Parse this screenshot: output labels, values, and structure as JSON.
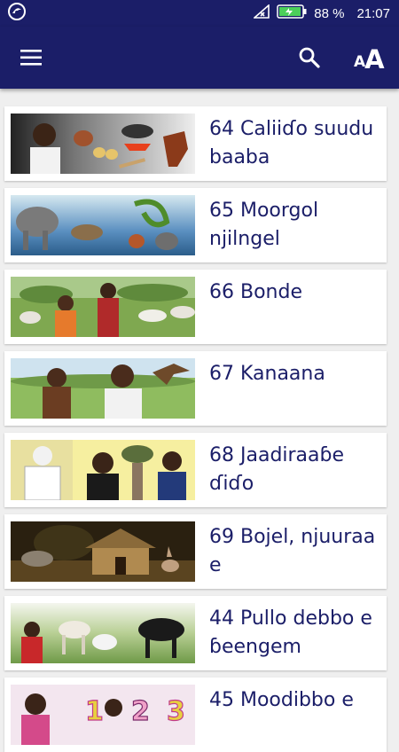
{
  "status_bar": {
    "battery_percent": "88 %",
    "time": "21:07",
    "icons": [
      "app-notification-icon",
      "signal-icon",
      "battery-icon"
    ]
  },
  "app_bar": {
    "menu_icon": "hamburger-menu-icon",
    "search_icon": "search-icon",
    "font_size_icon": "font-size-icon",
    "font_small": "A",
    "font_big": "A"
  },
  "lessons": [
    {
      "title": "64 Caliiɗo suudu baaba",
      "image": "man-chickens-pot-horse"
    },
    {
      "title": "65 Moorgol njilngel",
      "image": "elephant-hyena-snake-chicken-cat"
    },
    {
      "title": "66 Bonde",
      "image": "women-cattle-field"
    },
    {
      "title": "67 Kanaana",
      "image": "boy-old-man-eagle"
    },
    {
      "title": "68 Jaadiraaɓe ɗiɗo",
      "image": "elder-reading-young-men-baobab"
    },
    {
      "title": "69 Bojel, njuuraa e",
      "image": "hyena-hut-rabbit-night"
    },
    {
      "title": "44 Pullo debbo e ɓeengem",
      "image": "man-cattle-field"
    },
    {
      "title": "45 Moodibbo e",
      "image": "woman-children-numbers"
    }
  ],
  "colors": {
    "primary": "#1b1e68",
    "background": "#efefef",
    "card": "#ffffff",
    "title_text": "#1b1e68"
  }
}
